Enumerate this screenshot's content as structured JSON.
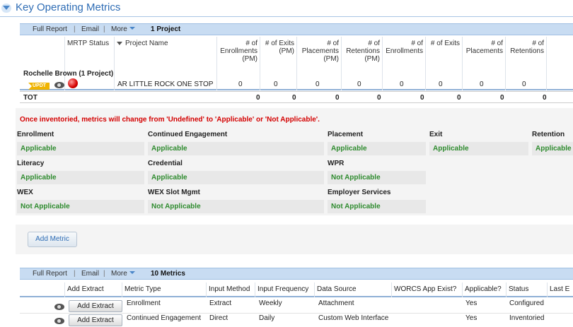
{
  "header": {
    "title": "Key Operating Metrics"
  },
  "toolbar1": {
    "full_report": "Full Report",
    "email": "Email",
    "more": "More",
    "count": "1 Project"
  },
  "table1": {
    "columns": [
      "MRTP Status",
      "Project Name",
      "# of Enrollments (PM)",
      "# of Exits (PM)",
      "# of Placements (PM)",
      "# of Retentions (PM)",
      "# of Enrollments",
      "# of Exits",
      "# of Placements",
      "# of Retentions"
    ],
    "group_label": "Rochelle Brown  (1 Project)",
    "badge": "UPDT",
    "row": {
      "project": "AR LITTLE ROCK ONE STOP",
      "values": [
        "0",
        "0",
        "0",
        "0",
        "0",
        "0",
        "0",
        "0"
      ]
    },
    "total": {
      "label": "TOT",
      "values": [
        "0",
        "0",
        "0",
        "0",
        "0",
        "0",
        "0",
        "0"
      ]
    }
  },
  "warning": "Once inventoried, metrics will change from 'Undefined' to 'Applicable' or 'Not Applicable'.",
  "metrics": [
    {
      "label": "Enrollment",
      "value": "Applicable"
    },
    {
      "label": "Continued Engagement",
      "value": "Applicable"
    },
    {
      "label": "Placement",
      "value": "Applicable"
    },
    {
      "label": "Exit",
      "value": "Applicable"
    },
    {
      "label": "Retention",
      "value": "Applicable"
    },
    {
      "label": "Literacy",
      "value": "Applicable"
    },
    {
      "label": "Credential",
      "value": "Applicable"
    },
    {
      "label": "WPR",
      "value": "Not Applicable"
    },
    {
      "label": "WEX",
      "value": "Not Applicable"
    },
    {
      "label": "WEX Slot Mgmt",
      "value": "Not Applicable"
    },
    {
      "label": "Employer Services",
      "value": "Not Applicable"
    }
  ],
  "add_metric_label": "Add  Metric",
  "toolbar2": {
    "full_report": "Full Report",
    "email": "Email",
    "more": "More",
    "count": "10 Metrics"
  },
  "table2": {
    "columns": [
      "Add Extract",
      "Metric Type",
      "Input Method",
      "Input Frequency",
      "Data Source",
      "WORCS App Exist?",
      "Applicable?",
      "Status",
      "Last E"
    ],
    "rows": [
      {
        "button": "Add Extract",
        "type": "Enrollment",
        "method": "Extract",
        "frequency": "Weekly",
        "source": "Attachment",
        "worcs": "",
        "applicable": "Yes",
        "status": "Configured"
      },
      {
        "button": "Add Extract",
        "type": "Continued Engagement",
        "method": "Direct",
        "frequency": "Daily",
        "source": "Custom Web Interface",
        "worcs": "",
        "applicable": "Yes",
        "status": "Inventoried"
      }
    ]
  },
  "colors": {
    "accent": "#2f6db5",
    "toolbar_bg": "#c8dcf2",
    "applicable_green": "#2e8b2e",
    "warning_red": "#d40000",
    "badge_gold": "#f0b400"
  }
}
